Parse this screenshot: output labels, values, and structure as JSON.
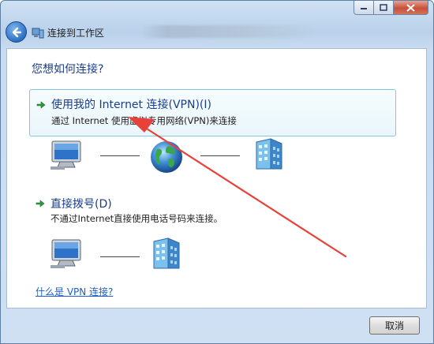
{
  "window": {
    "title": "连接到工作区",
    "colors": {
      "accent": "#1a3e8a",
      "selection_border": "#7ec9e0",
      "annotation": "#e8413a"
    }
  },
  "heading": "您想如何连接?",
  "options": [
    {
      "title": "使用我的 Internet 连接(VPN)(I)",
      "description": "通过 Internet 使用虚拟专用网络(VPN)来连接",
      "icons": [
        "computer-icon",
        "globe-icon",
        "office-building-icon"
      ]
    },
    {
      "title": "直接拨号(D)",
      "description": "不通过Internet直接使用电话号码来连接。",
      "icons": [
        "computer-icon",
        "office-building-icon"
      ]
    }
  ],
  "help_link": "什么是 VPN 连接?",
  "buttons": {
    "cancel": "取消"
  }
}
